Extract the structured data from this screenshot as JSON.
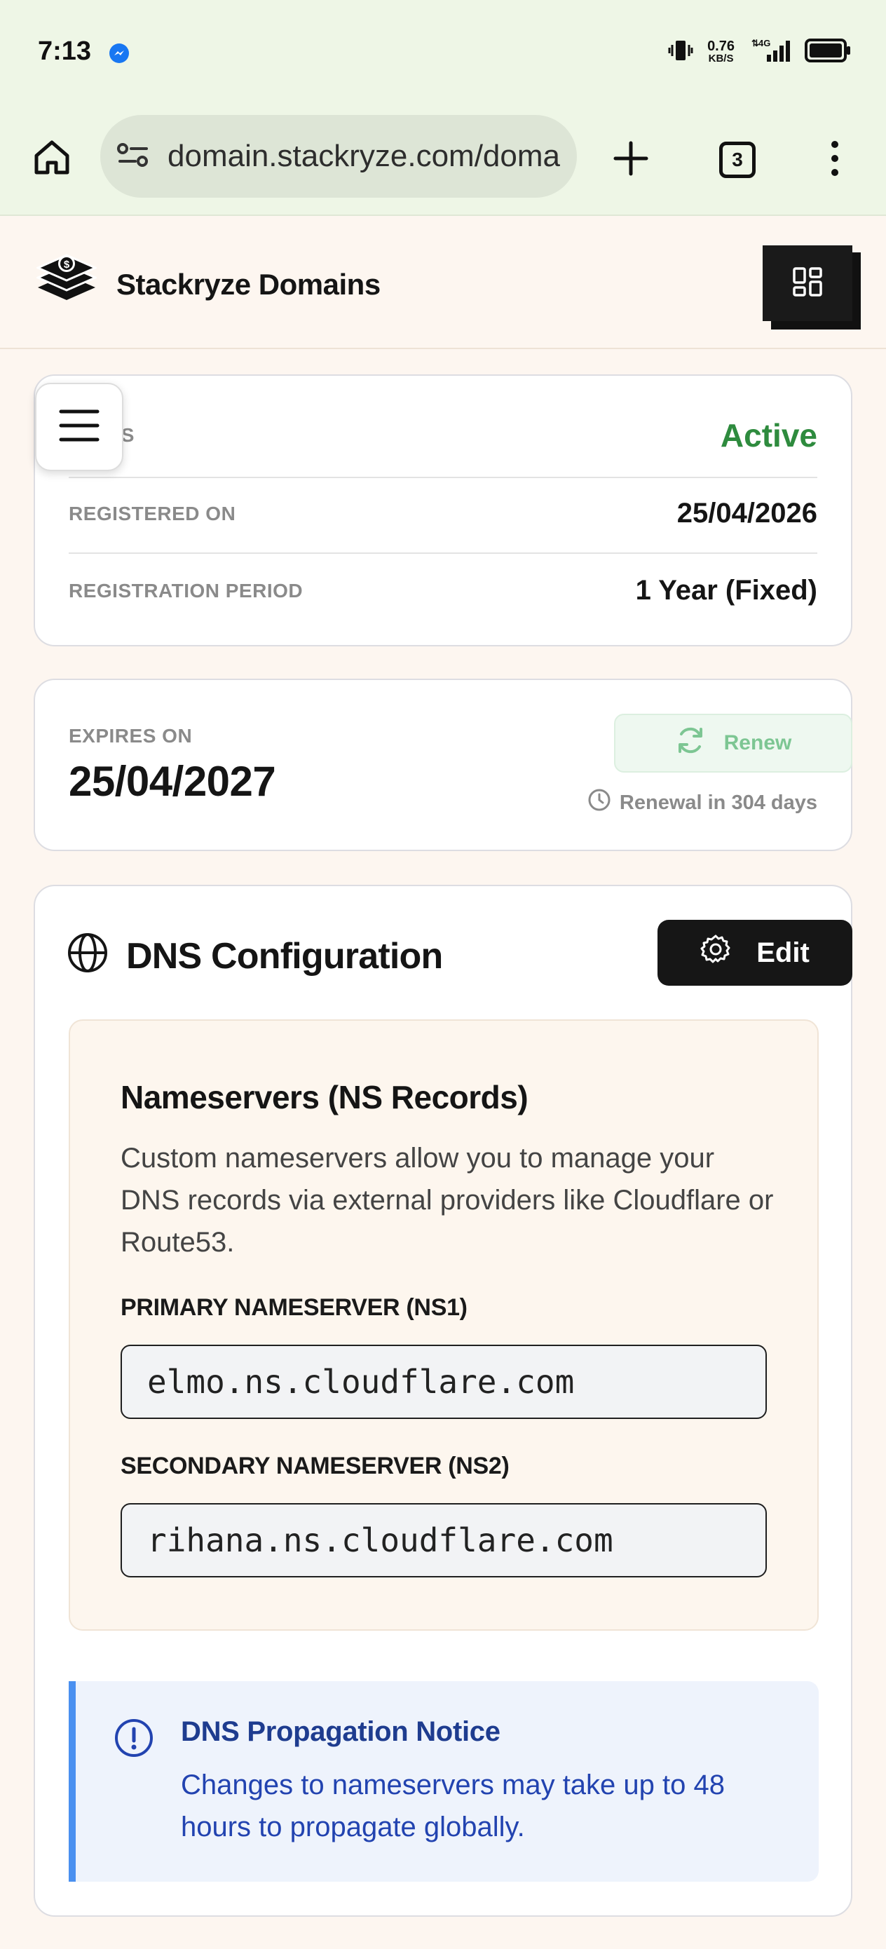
{
  "status_bar": {
    "time": "7:13",
    "speed_value": "0.76",
    "speed_unit": "KB/S",
    "network": "4G"
  },
  "browser": {
    "url": "domain.stackryze.com/doma",
    "tab_count": "3"
  },
  "site": {
    "brand": "Stackryze Domains"
  },
  "details_card": {
    "status_label": "US",
    "status_value": "Active",
    "registered_label": "REGISTERED ON",
    "registered_value": "25/04/2026",
    "period_label": "REGISTRATION PERIOD",
    "period_value": "1 Year (Fixed)"
  },
  "expiry_card": {
    "label": "EXPIRES ON",
    "date": "25/04/2027",
    "renew_label": "Renew",
    "renewal_info": "Renewal in 304 days"
  },
  "dns": {
    "title": "DNS Configuration",
    "edit_label": "Edit",
    "ns_title": "Nameservers (NS Records)",
    "ns_description": "Custom nameservers allow you to manage your DNS records via external providers like Cloudflare or Route53.",
    "ns1_label": "PRIMARY NAMESERVER (NS1)",
    "ns1_value": "elmo.ns.cloudflare.com",
    "ns2_label": "SECONDARY NAMESERVER (NS2)",
    "ns2_value": "rihana.ns.cloudflare.com",
    "notice_title": "DNS Propagation Notice",
    "notice_body": "Changes to nameservers may take up to 48 hours to propagate globally."
  },
  "colors": {
    "active_green": "#2e8b3e",
    "notice_blue": "#2243b0",
    "status_bar_bg": "#eef6e6",
    "page_bg": "#fdf6f0"
  }
}
